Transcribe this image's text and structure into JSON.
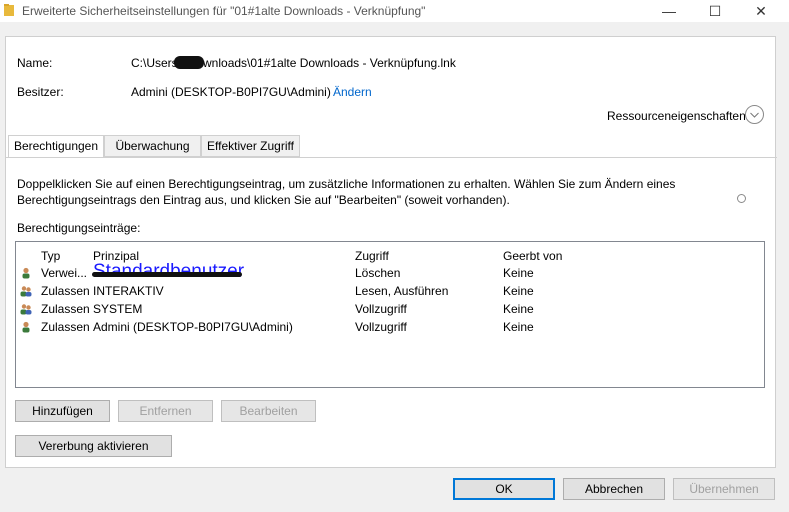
{
  "window": {
    "title": "Erweiterte Sicherheitseinstellungen für \"01#1alte Downloads - Verknüpfung\"",
    "minimize_glyph": "—",
    "maximize_glyph": "☐",
    "close_glyph": "✕"
  },
  "info": {
    "name_label": "Name:",
    "name_value": "C:\\Users\\     \\Downloads\\01#1alte Downloads - Verknüpfung.lnk",
    "owner_label": "Besitzer:",
    "owner_value": "Admini (DESKTOP-B0PI7GU\\Admini)",
    "change_link": "Ändern",
    "resource_props": "Ressourceneigenschaften"
  },
  "tabs": [
    "Berechtigungen",
    "Überwachung",
    "Effektiver Zugriff"
  ],
  "description": {
    "line1": "Doppelklicken Sie auf einen Berechtigungseintrag, um zusätzliche Informationen zu erhalten. Wählen Sie zum Ändern eines",
    "line2": "Berechtigungseintrags den Eintrag aus, und klicken Sie auf \"Bearbeiten\" (soweit vorhanden)."
  },
  "entries_label": "Berechtigungseinträge:",
  "table": {
    "columns": [
      "Typ",
      "Prinzipal",
      "Zugriff",
      "Geerbt von"
    ],
    "rows": [
      {
        "type": "Verwei...",
        "principal": "Standardbenutzer",
        "access": "Löschen",
        "inherited": "Keine",
        "icon": "single-user-icon"
      },
      {
        "type": "Zulassen",
        "principal": "INTERAKTIV",
        "access": "Lesen, Ausführen",
        "inherited": "Keine",
        "icon": "group-users-icon"
      },
      {
        "type": "Zulassen",
        "principal": "SYSTEM",
        "access": "Vollzugriff",
        "inherited": "Keine",
        "icon": "group-users-icon"
      },
      {
        "type": "Zulassen",
        "principal": "Admini (DESKTOP-B0PI7GU\\Admini)",
        "access": "Vollzugriff",
        "inherited": "Keine",
        "icon": "single-user-icon"
      }
    ]
  },
  "buttons": {
    "add": "Hinzufügen",
    "remove": "Entfernen",
    "edit": "Bearbeiten",
    "enable_inheritance": "Vererbung aktivieren",
    "ok": "OK",
    "cancel": "Abbrechen",
    "apply": "Übernehmen"
  },
  "colors": {
    "accent": "#0078d7",
    "link": "#0066cc",
    "annotation": "#1a1aff"
  }
}
